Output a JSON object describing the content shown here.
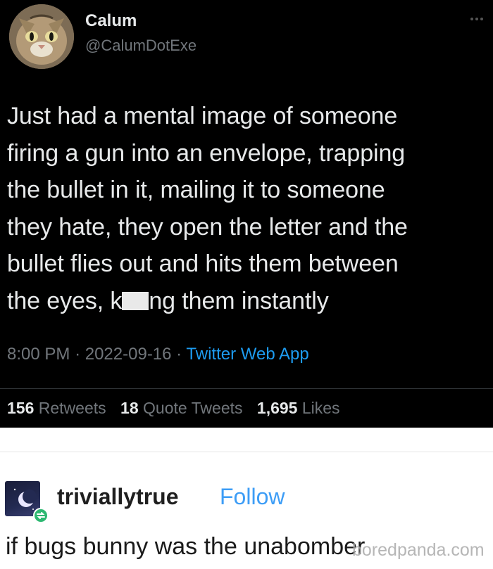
{
  "tweet": {
    "author_name": "Calum",
    "author_handle": "@CalumDotExe",
    "text_lines": [
      "Just had a mental image of someone",
      "firing a gun into an envelope, trapping",
      "the bullet in it, mailing it to someone",
      "they hate, they open the letter and the",
      "bullet flies out and hits them between"
    ],
    "last_line_before": "the eyes, k",
    "last_line_after": "ng them instantly",
    "time": "8:00 PM",
    "date": "2022-09-16",
    "source": "Twitter Web App",
    "retweets_count": "156",
    "retweets_label": "Retweets",
    "quotes_count": "18",
    "quotes_label": "Quote Tweets",
    "likes_count": "1,695",
    "likes_label": "Likes",
    "colors": {
      "background": "#000000",
      "text": "#e7e9ea",
      "muted": "#71767b",
      "link": "#1d9bf0"
    }
  },
  "tumblr": {
    "username": "triviallytrue",
    "follow_label": "Follow",
    "post_text": "if bugs bunny was the unabomber",
    "colors": {
      "follow": "#3d9df6",
      "reblog_badge": "#2eb872"
    }
  },
  "watermark": "boredpanda.com",
  "icons": {
    "more": "more-icon",
    "avatar": "cat-avatar",
    "tumblr_avatar": "moon-avatar",
    "reblog": "reblog-icon"
  }
}
